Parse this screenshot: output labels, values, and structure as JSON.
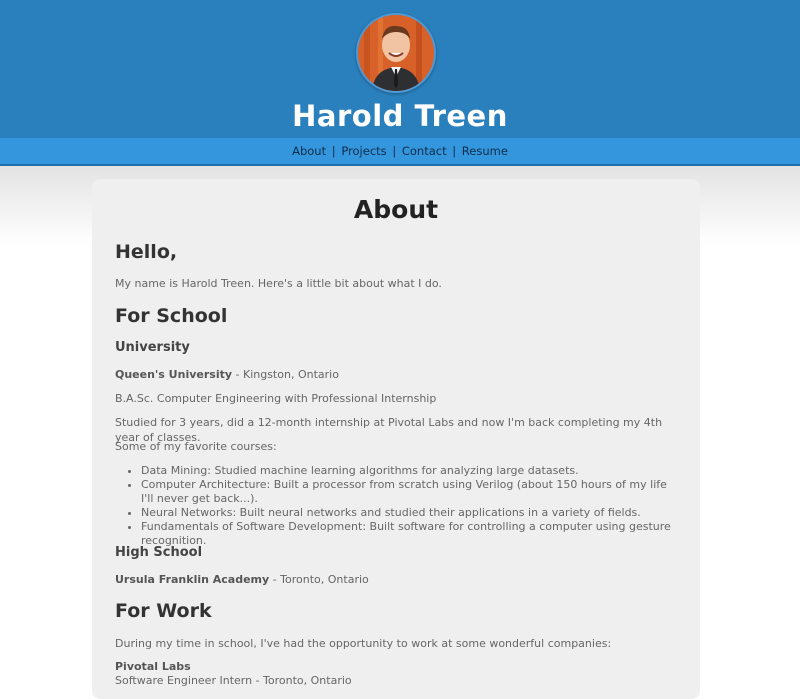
{
  "header": {
    "name": "Harold Treen"
  },
  "nav": {
    "about": "About",
    "projects": "Projects",
    "contact": "Contact",
    "resume": "Resume",
    "separator": "|"
  },
  "about": {
    "title": "About",
    "hello_heading": "Hello,",
    "intro": "My name is Harold Treen. Here's a little bit about what I do.",
    "school_heading": "For School",
    "university_heading": "University",
    "university_name": "Queen's University",
    "university_location": " - Kingston, Ontario",
    "degree": "B.A.Sc. Computer Engineering with Professional Internship",
    "studied": "Studied for 3 years, did a 12-month internship at Pivotal Labs and now I'm back completing my 4th year of classes.",
    "courses_intro": "Some of my favorite courses:",
    "courses": [
      "Data Mining: Studied machine learning algorithms for analyzing large datasets.",
      "Computer Architecture: Built a processor from scratch using Verilog (about 150 hours of my life I'll never get back...).",
      "Neural Networks: Built neural networks and studied their applications in a variety of fields.",
      "Fundamentals of Software Development: Built software for controlling a computer using gesture recognition."
    ],
    "highschool_heading": "High School",
    "highschool_name": "Ursula Franklin Academy",
    "highschool_location": " - Toronto, Ontario",
    "work_heading": "For Work",
    "work_intro": "During my time in school, I've had the opportunity to work at some wonderful companies:",
    "job_company": "Pivotal Labs",
    "job_title": "Software Engineer Intern - Toronto, Ontario"
  }
}
